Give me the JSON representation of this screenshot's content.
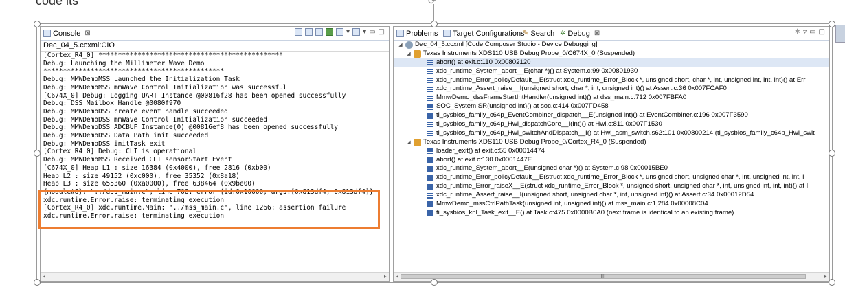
{
  "cut_text": "code its",
  "console": {
    "tab_label": "Console",
    "close_glyph": "⊠",
    "name": "Dec_04_5.ccxml:CIO",
    "lines": [
      "[Cortex_R4_0] ***********************************************",
      "Debug: Launching the Millimeter Wave Demo",
      "**********************************************",
      "Debug: MMWDemoMSS Launched the Initialization Task",
      "Debug: MMWDemoMSS mmWave Control Initialization was successful",
      "[C674X_0] Debug: Logging UART Instance @00816f28 has been opened successfully",
      "Debug: DSS Mailbox Handle @0080f970",
      "Debug: MMWDemoDSS create event handle succeeded",
      "Debug: MMWDemoDSS mmWave Control Initialization succeeded",
      "Debug: MMWDemoDSS ADCBUF Instance(0) @00816ef8 has been opened successfully",
      "Debug: MMWDemoDSS Data Path init succeeded",
      "Debug: MMWDemoDSS initTask exit",
      "[Cortex_R4_0] Debug: CLI is operational",
      "Debug: MMWDemoMSS Received CLI sensorStart Event",
      "[C674X_0] Heap L1 : size 16384 (0x4000), free 2816 (0xb00)",
      "Heap L2 : size 49152 (0xc000), free 35352 (0x8a18)",
      "Heap L3 : size 655360 (0xa0000), free 638464 (0x9be00)",
      "{module#8}: \"../dss_main.c\", line 708: error {id:0x10000, args:[0x813df4, 0x813df4]}",
      "xdc.runtime.Error.raise: terminating execution",
      "[Cortex_R4_0] xdc.runtime.Main: \"../mss_main.c\", line 1266: assertion failure",
      "xdc.runtime.Error.raise: terminating execution"
    ],
    "highlight_color": "#ed7d31"
  },
  "debug_tabs": [
    {
      "label": "Problems",
      "icon": "problems-icon"
    },
    {
      "label": "Target Configurations",
      "icon": "target-config-icon"
    },
    {
      "label": "Search",
      "icon": "search-icon"
    },
    {
      "label": "Debug",
      "icon": "debug-icon",
      "active": true
    }
  ],
  "debug": {
    "session": "Dec_04_5.ccxml [Code Composer Studio - Device Debugging]",
    "cores": [
      {
        "name": "Texas Instruments XDS110 USB Debug Probe_0/C674X_0 (Suspended)",
        "frames": [
          "abort() at exit.c:110 0x00802120",
          "xdc_runtime_System_abort__E(char *)() at System.c:99 0x00801930",
          "xdc_runtime_Error_policyDefault__E(struct xdc_runtime_Error_Block *, unsigned short, char *, int, unsigned int, int, int)() at Err",
          "xdc_runtime_Assert_raise__I(unsigned short, char *, int, unsigned int)() at Assert.c:36 0x007FCAF0",
          "MmwDemo_dssFrameStartIntHandler(unsigned int)() at dss_main.c:712 0x007FBFA0",
          "SOC_SystemISR(unsigned int)() at soc.c:414 0x007FD458",
          "ti_sysbios_family_c64p_EventCombiner_dispatch__E(unsigned int)() at EventCombiner.c:196 0x007F3590",
          "ti_sysbios_family_c64p_Hwi_dispatchCore__I(int)() at Hwi.c:811 0x007F1530",
          "ti_sysbios_family_c64p_Hwi_switchAndDispatch__I() at Hwi_asm_switch.s62:101 0x00800214  (ti_sysbios_family_c64p_Hwi_swit"
        ]
      },
      {
        "name": "Texas Instruments XDS110 USB Debug Probe_0/Cortex_R4_0 (Suspended)",
        "frames": [
          "loader_exit() at exit.c:55 0x00014474",
          "abort() at exit.c:130 0x0001447E",
          "xdc_runtime_System_abort__E(unsigned char *)() at System.c:98 0x00015BE0",
          "xdc_runtime_Error_policyDefault__E(struct xdc_runtime_Error_Block *, unsigned short, unsigned char *, int, unsigned int, int, i",
          "xdc_runtime_Error_raiseX__E(struct xdc_runtime_Error_Block *, unsigned short, unsigned char *, int, unsigned int, int, int)() at I",
          "xdc_runtime_Assert_raise__I(unsigned short, unsigned char *, int, unsigned int)() at Assert.c:34 0x00012D54",
          "MmwDemo_mssCtrlPathTask(unsigned int, unsigned int)() at mss_main.c:1,284 0x00008C04",
          "ti_sysbios_knl_Task_exit__E() at Task.c:475 0x0000B0A0  (next frame is identical to an existing frame)"
        ]
      }
    ]
  },
  "scroll_glyphs": {
    "left": "◂",
    "right": "▸",
    "grip": "III"
  }
}
